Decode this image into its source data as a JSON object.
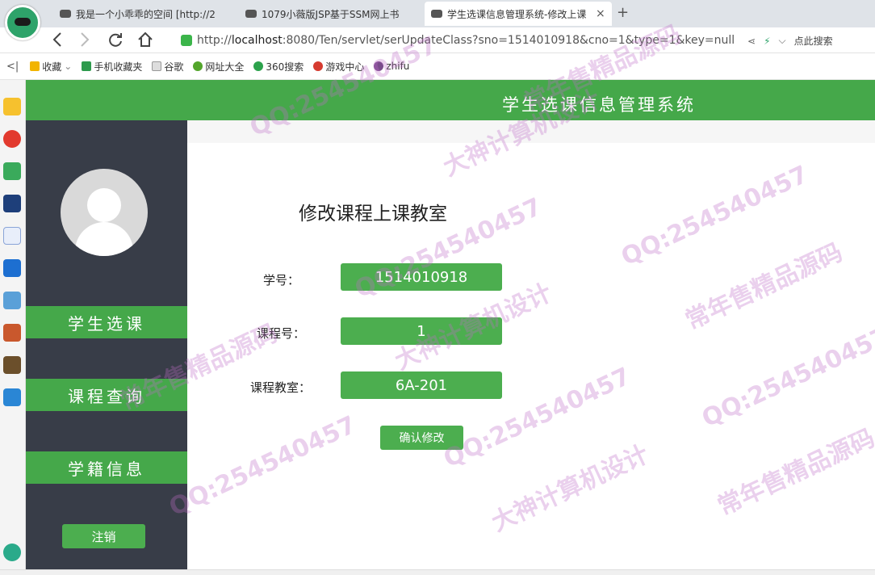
{
  "browser": {
    "tabs": [
      {
        "title": "我是一个小乖乖的空间 [http://2"
      },
      {
        "title": "1079小薇版JSP基于SSM网上书"
      },
      {
        "title": "学生选课信息管理系统-修改上课"
      }
    ],
    "close_glyph": "×",
    "new_tab_glyph": "+",
    "url_prefix": "http://",
    "url_host": "localhost",
    "url_rest": ":8080/Ten/servlet/serUpdateClass?sno=1514010918&cno=1&type=1&key=null",
    "search_label": "点此搜索",
    "nav_icons": [
      "back-icon",
      "forward-icon",
      "reload-icon",
      "home-icon"
    ],
    "bookmarks": [
      {
        "label": "收藏",
        "color": "#f2b400"
      },
      {
        "label": "手机收藏夹",
        "color": "#2e9a4d"
      },
      {
        "label": "谷歌",
        "color": "#888888"
      },
      {
        "label": "网址大全",
        "color": "#53a52b"
      },
      {
        "label": "360搜索",
        "color": "#2ca24c"
      },
      {
        "label": "游戏中心",
        "color": "#d63b30"
      },
      {
        "label": "zhifu",
        "color": "#7a4b8c"
      }
    ]
  },
  "app": {
    "title": "学生选课信息管理系统",
    "sidebar": {
      "menu": [
        {
          "label": "学生选课"
        },
        {
          "label": "课程查询"
        },
        {
          "label": "学籍信息"
        }
      ],
      "logout_label": "注销"
    },
    "form": {
      "title": "修改课程上课教室",
      "fields": [
        {
          "label": "学号：",
          "value": "1514010918"
        },
        {
          "label": "课程号：",
          "value": "1"
        },
        {
          "label": "课程教室：",
          "value": "6A-201"
        }
      ],
      "confirm_label": "确认修改"
    },
    "colors": {
      "accent": "#45a84a",
      "sidebar": "#383d48"
    }
  },
  "watermark": {
    "lines": [
      "QQ:254540457",
      "常年售精品源码",
      "大神计算机设计"
    ]
  }
}
